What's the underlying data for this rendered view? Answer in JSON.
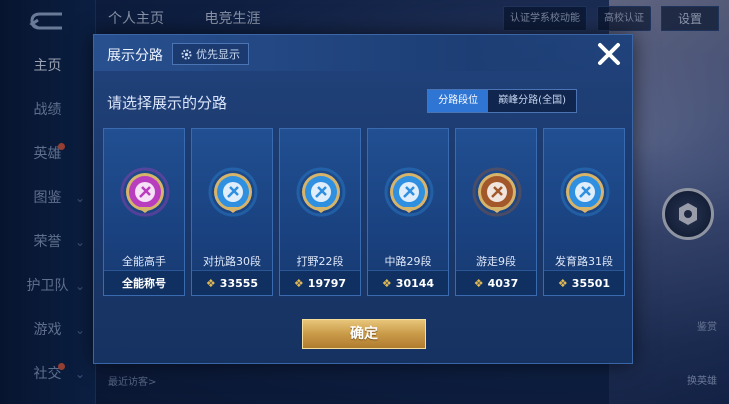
{
  "background": {
    "top_tabs": [
      "个人主页",
      "电竞生涯"
    ],
    "top_right": {
      "campus_label": "高校认证",
      "settings_label": "设置",
      "notice": "认证学系校动能"
    },
    "sidebar": [
      {
        "label": "主页",
        "active": true,
        "chevron": false,
        "dot": false
      },
      {
        "label": "战绩",
        "active": false,
        "chevron": false,
        "dot": false
      },
      {
        "label": "英雄",
        "active": false,
        "chevron": false,
        "dot": true
      },
      {
        "label": "图鉴",
        "active": false,
        "chevron": true,
        "dot": false
      },
      {
        "label": "荣誉",
        "active": false,
        "chevron": true,
        "dot": false
      },
      {
        "label": "护卫队",
        "active": false,
        "chevron": true,
        "dot": false
      },
      {
        "label": "游戏",
        "active": false,
        "chevron": true,
        "dot": false
      },
      {
        "label": "社交",
        "active": false,
        "chevron": true,
        "dot": true
      }
    ],
    "bottom_left": "最近访客>",
    "right_buttons": [
      "鉴赏",
      "换英雄"
    ]
  },
  "modal": {
    "title": "展示分路",
    "priority_label": "优先显示",
    "subtitle": "请选择展示的分路",
    "toggle": {
      "option1": "分路段位",
      "option2": "巅峰分路(全国)",
      "active": "option1"
    },
    "confirm_label": "确定",
    "cards": [
      {
        "label": "全能高手",
        "footer": "全能称号",
        "has_points": false,
        "badge_color": "#b93dbf",
        "icon": "all-rounder-badge-icon"
      },
      {
        "label": "对抗路30段",
        "footer": "33555",
        "has_points": true,
        "badge_color": "#2f8fe0",
        "icon": "clash-lane-badge-icon"
      },
      {
        "label": "打野22段",
        "footer": "19797",
        "has_points": true,
        "badge_color": "#2f8fe0",
        "icon": "jungle-badge-icon"
      },
      {
        "label": "中路29段",
        "footer": "30144",
        "has_points": true,
        "badge_color": "#2f8fe0",
        "icon": "mid-lane-badge-icon"
      },
      {
        "label": "游走9段",
        "footer": "4037",
        "has_points": true,
        "badge_color": "#a2582a",
        "icon": "roam-badge-icon"
      },
      {
        "label": "发育路31段",
        "footer": "35501",
        "has_points": true,
        "badge_color": "#2f8fe0",
        "icon": "farm-lane-badge-icon"
      }
    ]
  }
}
